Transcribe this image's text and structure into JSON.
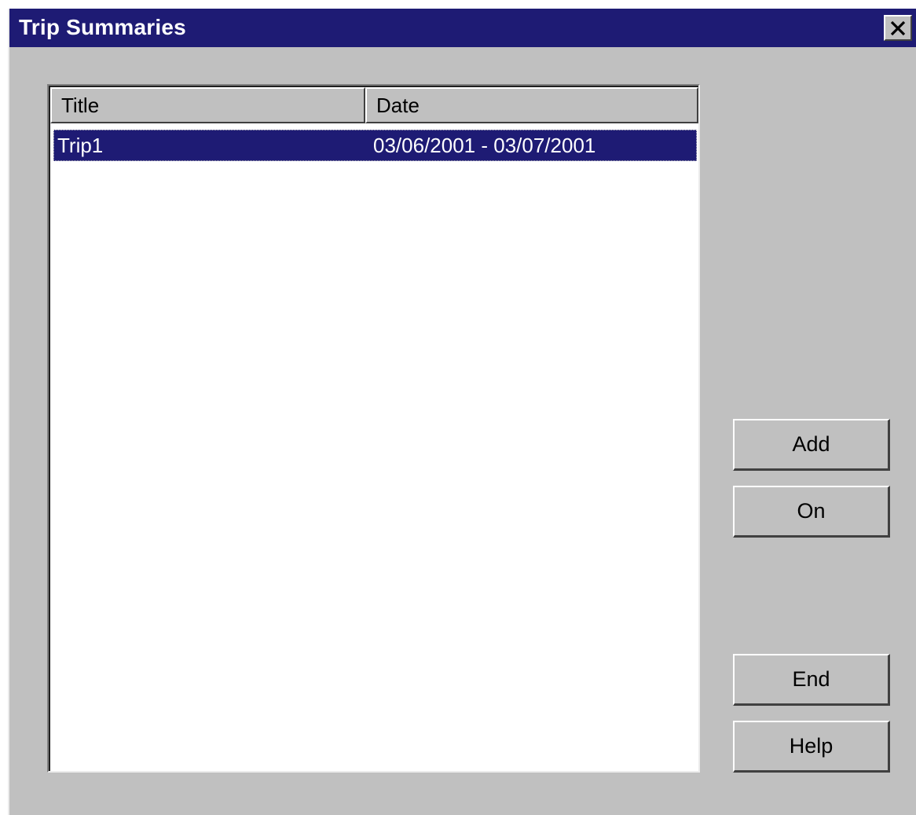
{
  "window": {
    "title": "Trip Summaries",
    "close_icon": "close-icon"
  },
  "colors": {
    "titlebar": "#1e1b74",
    "dialog_bg": "#c0c0c0",
    "selection": "#1e1b74"
  },
  "list": {
    "columns": [
      "Title",
      "Date"
    ],
    "rows": [
      {
        "title": "Trip1",
        "date": "03/06/2001 - 03/07/2001",
        "selected": true
      }
    ]
  },
  "buttons": {
    "add": "Add",
    "on": "On",
    "end": "End",
    "help": "Help"
  }
}
